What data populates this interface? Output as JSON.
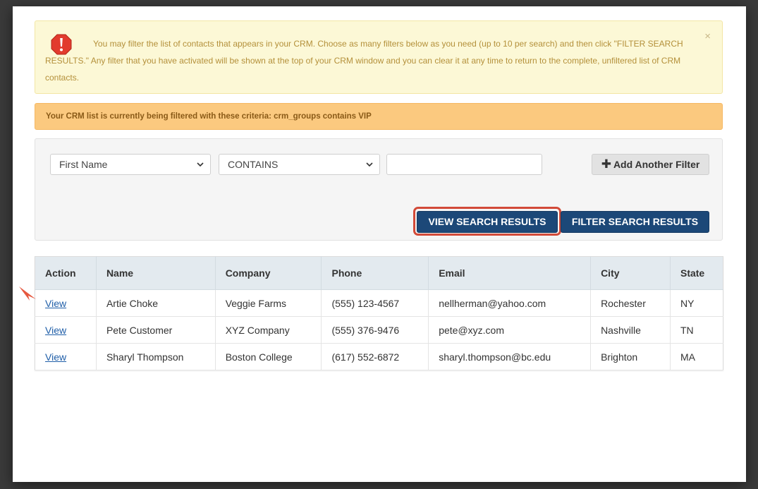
{
  "alert": {
    "message": "You may filter the list of contacts that appears in your CRM. Choose as many filters below as you need (up to 10 per search) and then click \"FILTER SEARCH RESULTS.\" Any filter that you have activated will be shown at the top of your CRM window and you can clear it at any time to return to the complete, unfiltered list of CRM contacts.",
    "close_label": "×",
    "icon": "exclamation-icon"
  },
  "active_filter": {
    "message": "Your CRM list is currently being filtered with these criteria: crm_groups contains VIP"
  },
  "filter": {
    "field_value": "First Name",
    "operator_value": "CONTAINS",
    "text_value": "",
    "add_label": "Add Another Filter",
    "add_icon": "plus-icon",
    "view_label": "VIEW SEARCH RESULTS",
    "filter_label": "FILTER SEARCH RESULTS"
  },
  "table": {
    "headers": [
      "Action",
      "Name",
      "Company",
      "Phone",
      "Email",
      "City",
      "State"
    ],
    "rows": [
      {
        "action": "View",
        "name": "Artie Choke",
        "company": "Veggie Farms",
        "phone": "(555) 123-4567",
        "email": "nellherman@yahoo.com",
        "city": "Rochester",
        "state": "NY"
      },
      {
        "action": "View",
        "name": "Pete Customer",
        "company": "XYZ Company",
        "phone": "(555) 376-9476",
        "email": "pete@xyz.com",
        "city": "Nashville",
        "state": "TN"
      },
      {
        "action": "View",
        "name": "Sharyl Thompson",
        "company": "Boston College",
        "phone": "(617) 552-6872",
        "email": "sharyl.thompson@bc.edu",
        "city": "Brighton",
        "state": "MA"
      }
    ]
  },
  "colors": {
    "primary_button": "#1c4878",
    "highlight": "#d24a38",
    "alert_bg": "#fcf8d6",
    "warning_bg": "#fbc97f"
  }
}
